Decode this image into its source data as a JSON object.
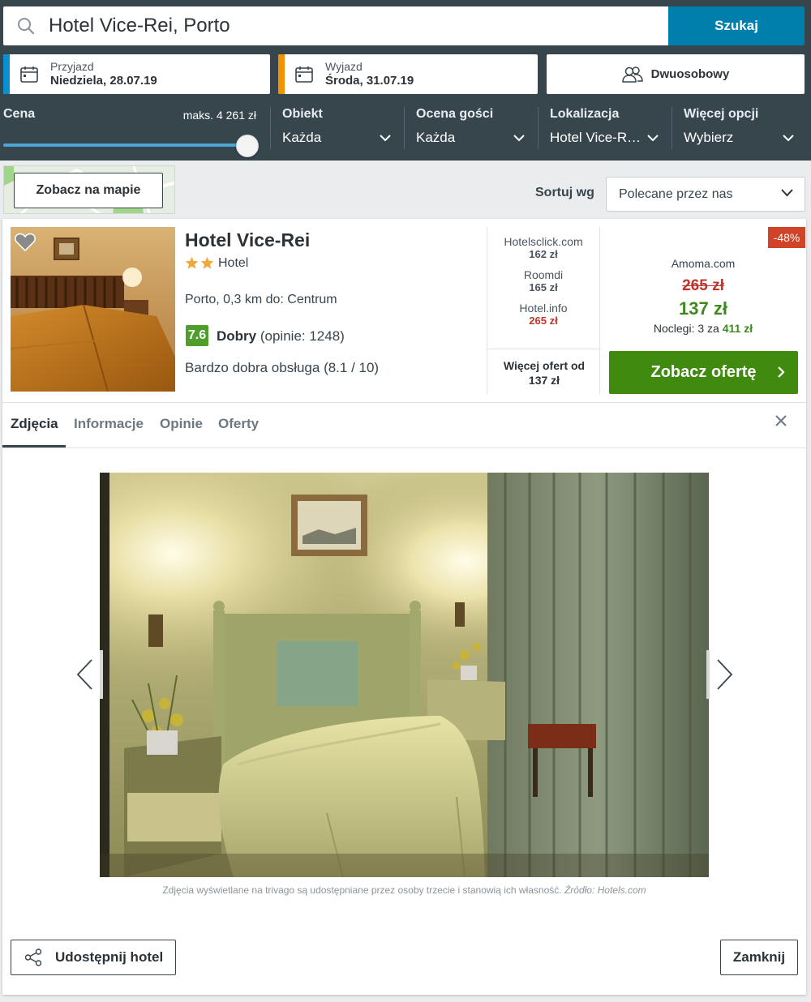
{
  "search": {
    "query": "Hotel Vice-Rei, Porto",
    "button": "Szukaj",
    "icon": "search-icon"
  },
  "dates": {
    "checkin_label": "Przyjazd",
    "checkin_value": "Niedziela, 28.07.19",
    "checkin_color": "#0a8fd0",
    "checkout_label": "Wyjazd",
    "checkout_value": "Środa, 31.07.19",
    "checkout_color": "#f39200"
  },
  "room": {
    "label": "Dwuosobowy",
    "icon": "guests-icon"
  },
  "filters": {
    "price_label": "Cena",
    "price_max": "maks. 4 261 zł",
    "price_slider_fraction": 1.0,
    "items": [
      {
        "label": "Obiekt",
        "value": "Każda"
      },
      {
        "label": "Ocena gości",
        "value": "Każda"
      },
      {
        "label": "Lokalizacja",
        "value": "Hotel Vice-R…"
      },
      {
        "label": "Więcej opcji",
        "value": "Wybierz"
      }
    ]
  },
  "map": {
    "button": "Zobacz na mapie"
  },
  "sort": {
    "label": "Sortuj wg",
    "value": "Polecane przez nas"
  },
  "hotel": {
    "name": "Hotel Vice-Rei",
    "stars": 2,
    "type": "Hotel",
    "location": "Porto, 0,3 km do: Centrum",
    "rating": "7.6",
    "rating_word": "Dobry",
    "rating_count": "(opinie: 1248)",
    "sub_rating": "Bardzo dobra obsługa (8.1 / 10)"
  },
  "offers": [
    {
      "site": "Hotelsclick.com",
      "price": "162 zł"
    },
    {
      "site": "Roomdi",
      "price": "165 zł"
    },
    {
      "site": "Hotel.info",
      "price": "265 zł"
    }
  ],
  "more_offers": {
    "line1": "Więcej ofert od",
    "line2": "137 zł"
  },
  "best_deal": {
    "discount": "-48%",
    "site": "Amoma.com",
    "old_price": "265 zł",
    "new_price": "137 zł",
    "nights_prefix": "Noclegi: 3 za",
    "nights_total": "411 zł",
    "cta": "Zobacz ofertę"
  },
  "tabs": [
    {
      "label": "Zdjęcia",
      "active": true
    },
    {
      "label": "Informacje",
      "active": false
    },
    {
      "label": "Opinie",
      "active": false
    },
    {
      "label": "Oferty",
      "active": false
    }
  ],
  "gallery": {
    "credit_text": "Zdjęcia wyświetlane na trivago są udostępniane przez osoby trzecie i stanowią ich własność.",
    "credit_source": "Źródło: Hotels.com"
  },
  "footer": {
    "share": "Udostępnij hotel",
    "close": "Zamknij"
  },
  "colors": {
    "header_bg": "#37454d",
    "search_button": "#007fad",
    "rating_green": "#4f9e2c",
    "cta_green": "#3f8a0f",
    "discount_red": "#d14328"
  }
}
